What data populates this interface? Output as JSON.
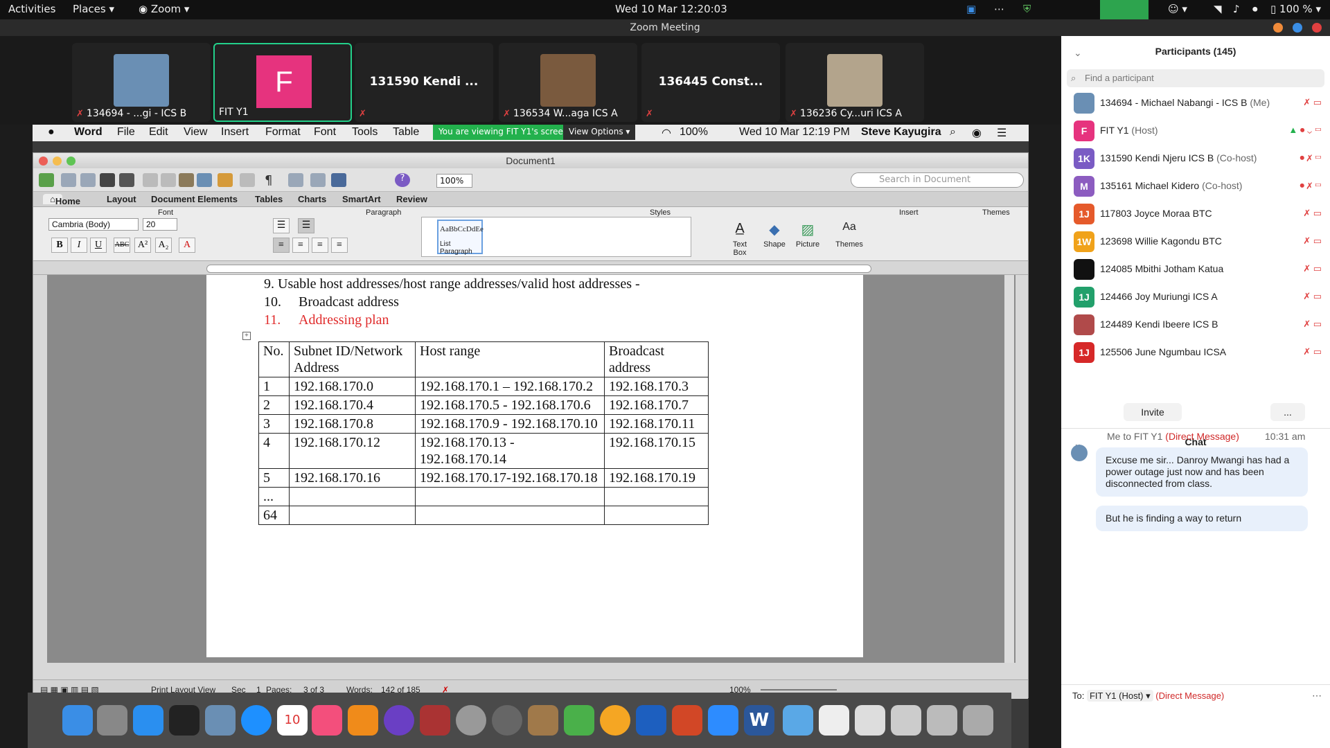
{
  "topbar": {
    "activities": "Activities",
    "places": "Places",
    "app": "Zoom",
    "clock": "Wed 10 Mar  12:20:03",
    "battery": "100 %"
  },
  "zoom_title": "Zoom Meeting",
  "thumbnails": [
    {
      "name": "134694 - ...gi - ICS B",
      "type": "photo",
      "color": "#6a8fb4"
    },
    {
      "name": "FIT Y1",
      "type": "letter",
      "letter": "F"
    },
    {
      "name": "131590 Kendi ...",
      "type": "text"
    },
    {
      "name": "136534 W...aga ICS A",
      "type": "photo",
      "color": "#7a5a3e"
    },
    {
      "name": "136445 Const...",
      "type": "text"
    },
    {
      "name": "136236 Cy...uri  ICS A",
      "type": "photo",
      "color": "#b3a48c"
    }
  ],
  "share": {
    "banner": "You are viewing FIT Y1's screen",
    "view_options": "View Options"
  },
  "mac_menu": {
    "app": "Word",
    "items": [
      "File",
      "Edit",
      "View",
      "Insert",
      "Format",
      "Font",
      "Tools",
      "Table"
    ],
    "battery": "100%",
    "clock": "Wed 10 Mar  12:19 PM",
    "user": "Steve Kayugira"
  },
  "word": {
    "doc_title": "Document1",
    "zoom": "100%",
    "search_placeholder": "Search in Document",
    "tabs": [
      "Home",
      "Layout",
      "Document Elements",
      "Tables",
      "Charts",
      "SmartArt",
      "Review"
    ],
    "groups": {
      "font": "Font",
      "paragraph": "Paragraph",
      "styles": "Styles",
      "insert": "Insert",
      "themes": "Themes"
    },
    "font_name": "Cambria (Body)",
    "font_size": "20",
    "style_preview": "AaBbCcDdEe",
    "style_name": "List Paragraph",
    "insert_items": [
      "Text Box",
      "Shape",
      "Picture"
    ],
    "themes_label": "Themes",
    "lines": [
      {
        "num": "9.",
        "text": "Usable host addresses/host range addresses/valid host addresses -"
      },
      {
        "num": "10.",
        "text": "Broadcast address"
      },
      {
        "num": "11.",
        "text": "Addressing plan"
      }
    ],
    "table": {
      "headers": [
        "No.",
        "Subnet ID/Network Address",
        "Host range",
        "Broadcast address"
      ],
      "rows": [
        [
          "1",
          "192.168.170.0",
          "192.168.170.1 – 192.168.170.2",
          "192.168.170.3"
        ],
        [
          "2",
          "192.168.170.4",
          "192.168.170.5 - 192.168.170.6",
          "192.168.170.7"
        ],
        [
          "3",
          "192.168.170.8",
          "192.168.170.9 - 192.168.170.10",
          "192.168.170.11"
        ],
        [
          "4",
          "192.168.170.12",
          "192.168.170.13 - 192.168.170.14",
          "192.168.170.15"
        ],
        [
          "5",
          "192.168.170.16",
          "192.168.170.17-192.168.170.18",
          "192.168.170.19"
        ],
        [
          "...",
          "",
          "",
          ""
        ],
        [
          "64",
          "",
          "",
          ""
        ]
      ]
    },
    "status": {
      "view": "Print Layout View",
      "sec_label": "Sec",
      "sec": "1",
      "pages_label": "Pages:",
      "pages": "3 of 3",
      "words_label": "Words:",
      "words": "142 of 185",
      "zoom": "100%"
    }
  },
  "participants": {
    "title": "Participants (145)",
    "find_placeholder": "Find a participant",
    "list": [
      {
        "initials": "",
        "name": "134694 - Michael Nabangi - ICS B",
        "tag": "(Me)",
        "color": "#6a8fb4"
      },
      {
        "initials": "F",
        "name": "FIT Y1",
        "tag": "(Host)",
        "color": "#e6337e"
      },
      {
        "initials": "1K",
        "name": "131590 Kendi Njeru ICS B",
        "tag": "(Co-host)",
        "color": "#7a5bc4"
      },
      {
        "initials": "M",
        "name": "135161 Michael Kidero",
        "tag": "(Co-host)",
        "color": "#8c5cc0"
      },
      {
        "initials": "1J",
        "name": "117803 Joyce Moraa BTC",
        "tag": "",
        "color": "#e55a2b"
      },
      {
        "initials": "1W",
        "name": "123698 Willie Kagondu BTC",
        "tag": "",
        "color": "#f0a21a"
      },
      {
        "initials": "",
        "name": "124085 Mbithi Jotham Katua",
        "tag": "",
        "color": "#111111"
      },
      {
        "initials": "1J",
        "name": "124466 Joy Muriungi ICS A",
        "tag": "",
        "color": "#22a06b"
      },
      {
        "initials": "",
        "name": "124489 Kendi Ibeere ICS B",
        "tag": "",
        "color": "#b04a4a"
      },
      {
        "initials": "1J",
        "name": "125506 June Ngumbau ICSA",
        "tag": "",
        "color": "#d62828"
      }
    ],
    "invite": "Invite",
    "more": "..."
  },
  "chat": {
    "title": "Chat",
    "from": "Me to FIT Y1",
    "dm": "(Direct Message)",
    "time": "10:31 am",
    "messages": [
      "Excuse me sir... Danroy Mwangi has had a power outage just now and has been disconnected from class.",
      "But he is finding a way to return"
    ],
    "to_label": "To:",
    "to": "FIT Y1 (Host)",
    "to_dm": "(Direct Message)"
  }
}
